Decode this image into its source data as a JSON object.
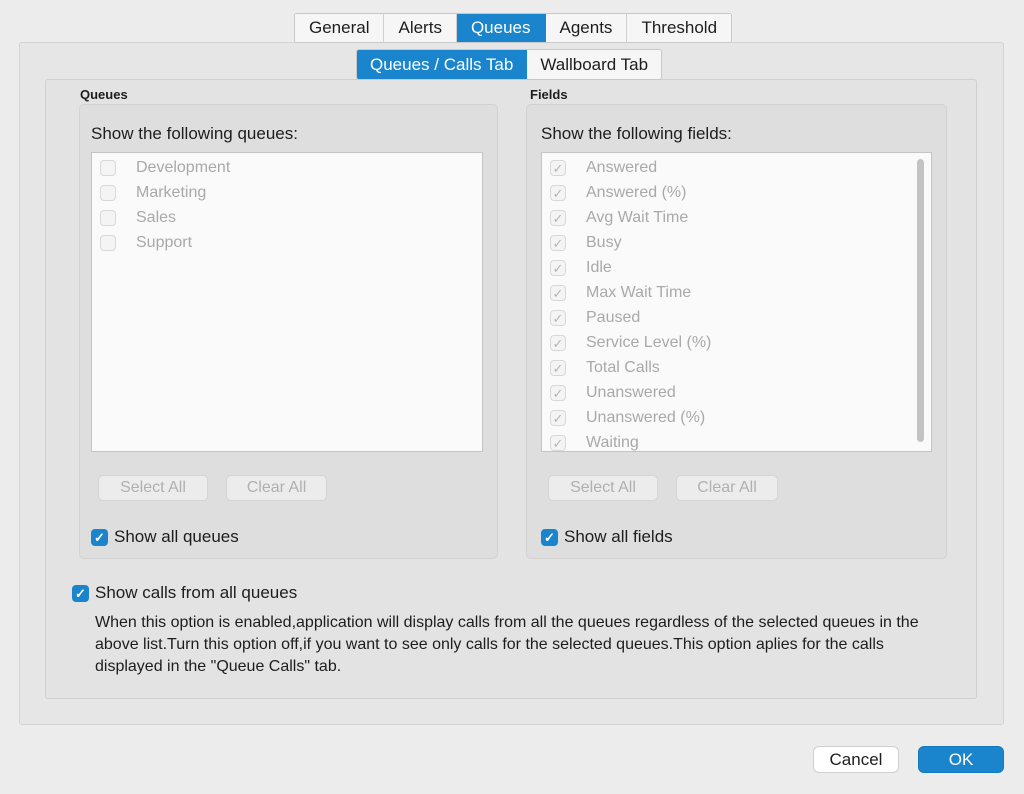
{
  "top_tabs": [
    "General",
    "Alerts",
    "Queues",
    "Agents",
    "Threshold"
  ],
  "sub_tabs": [
    "Queues / Calls Tab",
    "Wallboard Tab"
  ],
  "queues": {
    "title": "Queues",
    "heading": "Show the following queues:",
    "items": [
      "Development",
      "Marketing",
      "Sales",
      "Support"
    ],
    "select_all": "Select All",
    "clear_all": "Clear All",
    "show_all_label": "Show all queues"
  },
  "fields": {
    "title": "Fields",
    "heading": "Show the following fields:",
    "items": [
      "Answered",
      "Answered (%)",
      "Avg Wait Time",
      "Busy",
      "Idle",
      "Max Wait Time",
      "Paused",
      "Service Level (%)",
      "Total Calls",
      "Unanswered",
      "Unanswered (%)",
      "Waiting"
    ],
    "select_all": "Select All",
    "clear_all": "Clear All",
    "show_all_label": "Show all fields"
  },
  "show_calls": {
    "label": "Show calls from all queues",
    "description": "When this option is enabled,application will display calls from all the queues regardless of the selected queues in the above list.Turn this option off,if you want to see only calls for the selected queues.This option aplies for the calls displayed in the \"Queue Calls\" tab."
  },
  "footer": {
    "cancel": "Cancel",
    "ok": "OK"
  },
  "colors": {
    "accent": "#1a85cc"
  }
}
